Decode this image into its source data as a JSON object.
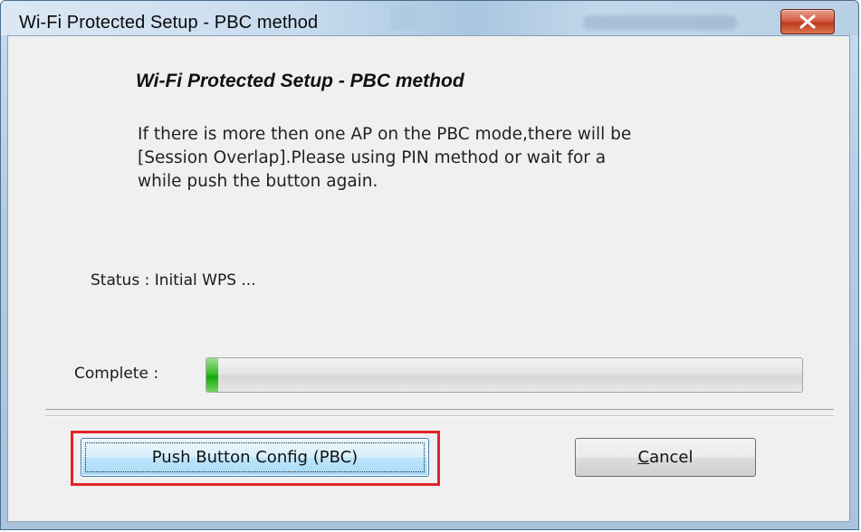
{
  "window": {
    "title": "Wi-Fi Protected Setup - PBC method"
  },
  "titlebar": {
    "close_icon": "close-icon"
  },
  "dialog": {
    "heading": "Wi-Fi Protected Setup - PBC method",
    "description_lines": [
      "If there is more then one AP on the PBC mode,there will be",
      "[Session Overlap].Please using PIN method or wait for a",
      "while push the button again."
    ],
    "status_text": "Status : Initial WPS ...",
    "complete_label": "Complete :",
    "progress_fraction": 0.02
  },
  "buttons": {
    "pbc_label": "Push Button Config (PBC)",
    "cancel_mnemonic": "C",
    "cancel_rest": "ancel"
  },
  "colors": {
    "highlight_border": "#e2242b",
    "progress_green": "#17a90b",
    "close_red": "#c1391d"
  }
}
